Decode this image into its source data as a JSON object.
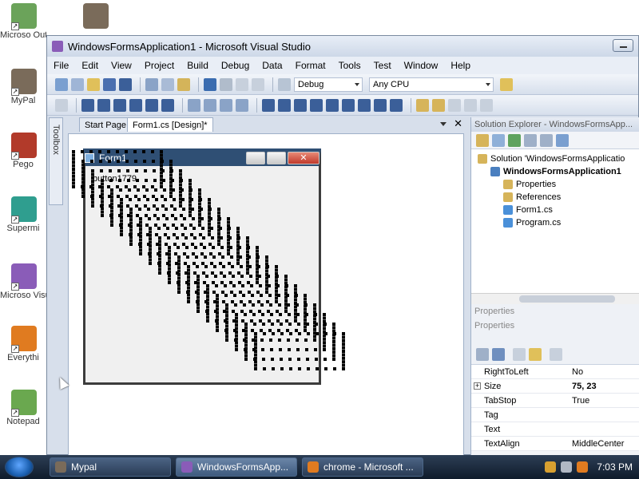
{
  "desktop": {
    "icons": [
      {
        "label": "Microso Outloo",
        "color": "#6ba35a"
      },
      {
        "label": "MyPal",
        "color": "#7a6b5a"
      },
      {
        "label": "Pego",
        "color": "#b23a2a"
      },
      {
        "label": "Supermi",
        "color": "#2f9e8f"
      },
      {
        "label": "Microso Visual S",
        "color": "#8a5cb8"
      },
      {
        "label": "Everythi",
        "color": "#e07b20"
      },
      {
        "label": "Notepad",
        "color": "#6aa84f"
      }
    ],
    "top_icon_color": "#7a6b5a"
  },
  "window": {
    "title": "WindowsFormsApplication1 - Microsoft Visual Studio"
  },
  "menu": [
    "File",
    "Edit",
    "View",
    "Project",
    "Build",
    "Debug",
    "Data",
    "Format",
    "Tools",
    "Test",
    "Window",
    "Help"
  ],
  "toolbar": {
    "config_combo": "Debug",
    "platform_combo": "Any CPU"
  },
  "toolbox": {
    "label": "Toolbox"
  },
  "tabs": [
    {
      "label": "Start Page"
    },
    {
      "label": "Form1.cs [Design]*"
    }
  ],
  "form": {
    "title": "Form1",
    "button_text": "button1779"
  },
  "solution_explorer": {
    "header": "Solution Explorer - WindowsFormsApp...",
    "items": [
      {
        "label": "Solution 'WindowsFormsApplicatio",
        "indent": 0,
        "color": "#d6b45a"
      },
      {
        "label": "WindowsFormsApplication1",
        "indent": 1,
        "color": "#4a7fbf"
      },
      {
        "label": "Properties",
        "indent": 2,
        "color": "#d6b45a"
      },
      {
        "label": "References",
        "indent": 2,
        "color": "#d6b45a"
      },
      {
        "label": "Form1.cs",
        "indent": 2,
        "color": "#4a90d9"
      },
      {
        "label": "Program.cs",
        "indent": 2,
        "color": "#4a90d9"
      }
    ]
  },
  "properties": {
    "tab_label": "Properties",
    "header_label": "Properties",
    "rows": [
      {
        "key": "RightToLeft",
        "value": "No",
        "bold": false,
        "plus": false
      },
      {
        "key": "Size",
        "value": "75, 23",
        "bold": true,
        "plus": true
      },
      {
        "key": "TabStop",
        "value": "True",
        "bold": false,
        "plus": false
      },
      {
        "key": "Tag",
        "value": "",
        "bold": false,
        "plus": false
      },
      {
        "key": "Text",
        "value": "",
        "bold": false,
        "plus": false
      },
      {
        "key": "TextAlign",
        "value": "MiddleCenter",
        "bold": false,
        "plus": false
      }
    ]
  },
  "taskbar": {
    "tasks": [
      {
        "label": "Mypal",
        "color": "#7a6b5a",
        "active": false
      },
      {
        "label": "WindowsFormsApp...",
        "color": "#8a5cb8",
        "active": true
      },
      {
        "label": "chrome - Microsoft ...",
        "color": "#e07b20",
        "active": false
      }
    ],
    "clock": "7:03 PM"
  }
}
